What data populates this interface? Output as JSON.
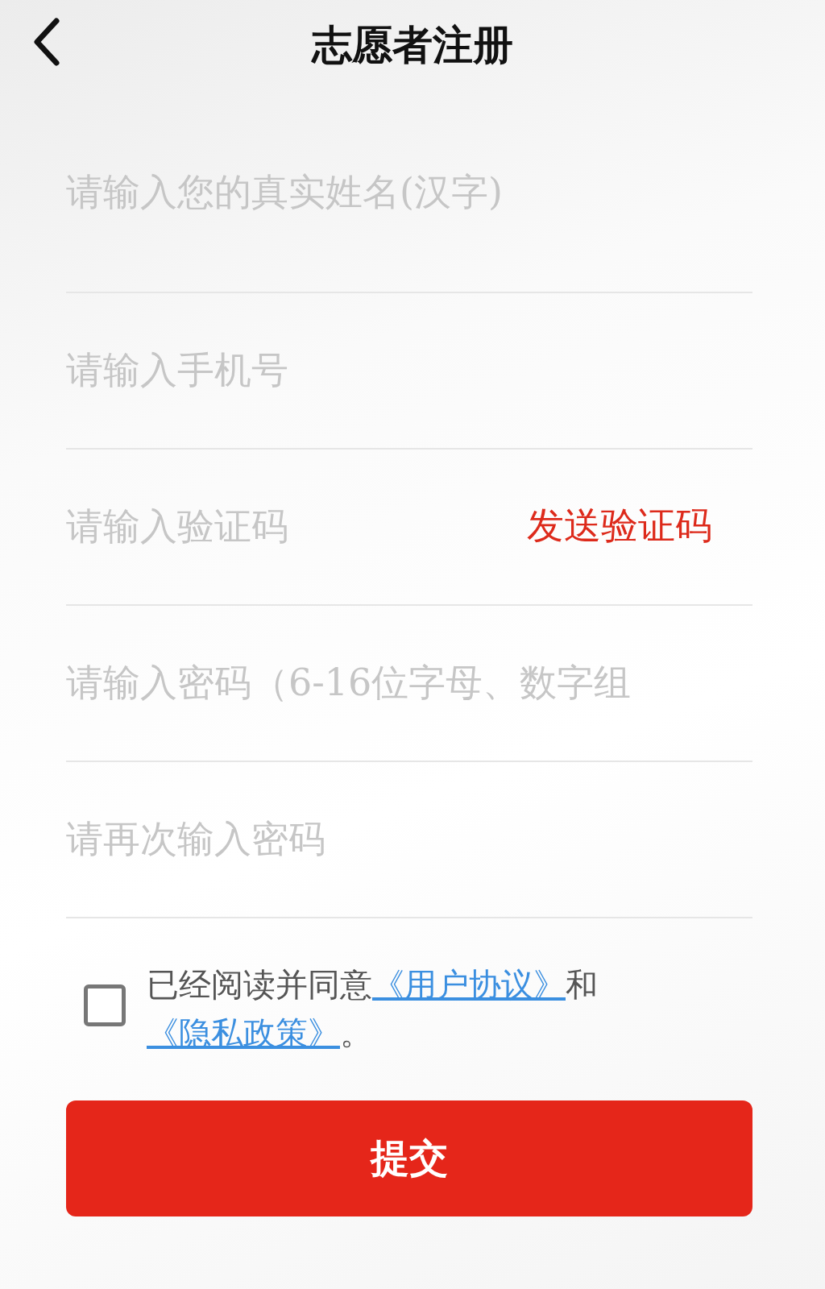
{
  "header": {
    "title": "志愿者注册"
  },
  "fields": [
    {
      "placeholder": "请输入您的真实姓名(汉字)"
    },
    {
      "placeholder": "请输入手机号"
    },
    {
      "placeholder": "请输入验证码",
      "action": "发送验证码"
    },
    {
      "placeholder": "请输入密码（6-16位字母、数字组"
    },
    {
      "placeholder": "请再次输入密码"
    }
  ],
  "agreement": {
    "checked": false,
    "parts": [
      {
        "kind": "text",
        "text": "已经阅读并同意"
      },
      {
        "kind": "link",
        "text": "《用户协议》"
      },
      {
        "kind": "text",
        "text": "和"
      },
      {
        "kind": "link",
        "text": "《隐私政策》"
      },
      {
        "kind": "text",
        "text": "。"
      }
    ]
  },
  "submit": "提交"
}
